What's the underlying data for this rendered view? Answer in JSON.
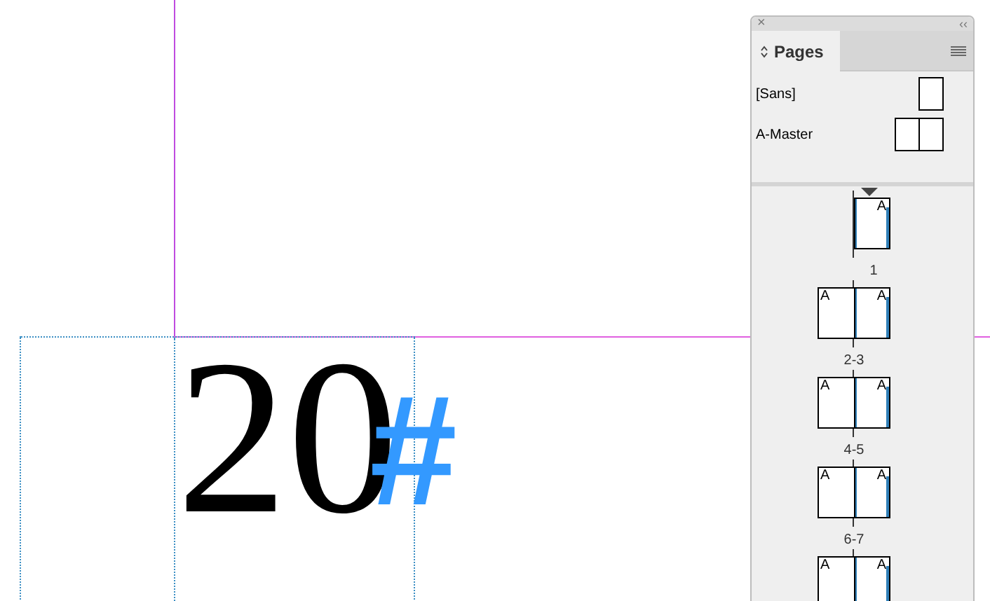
{
  "canvas": {
    "text": "20",
    "glyph": "#"
  },
  "panel": {
    "close": "×",
    "collapse": "‹‹",
    "tab": {
      "label": "Pages",
      "selected": true
    },
    "masters": [
      {
        "name": "[Sans]",
        "kind": "single"
      },
      {
        "name": "A-Master",
        "kind": "spread"
      }
    ],
    "pages": [
      {
        "kind": "single",
        "current": true,
        "prefixes": [
          "A"
        ],
        "label": "1"
      },
      {
        "kind": "spread",
        "current": false,
        "prefixes": [
          "A",
          "A"
        ],
        "label": "2-3"
      },
      {
        "kind": "spread",
        "current": false,
        "prefixes": [
          "A",
          "A"
        ],
        "label": "4-5"
      },
      {
        "kind": "spread",
        "current": false,
        "prefixes": [
          "A",
          "A"
        ],
        "label": "6-7"
      },
      {
        "kind": "spread",
        "current": false,
        "prefixes": [
          "A",
          "A"
        ]
      }
    ]
  }
}
